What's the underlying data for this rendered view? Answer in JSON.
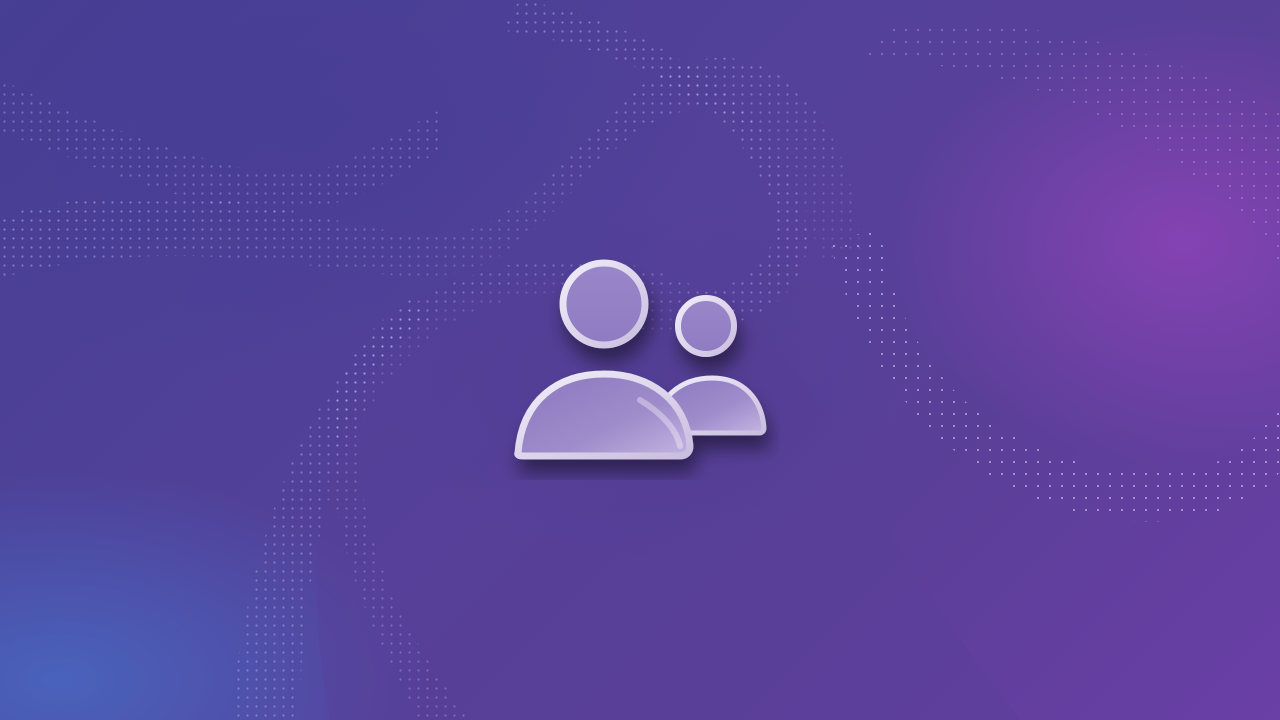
{
  "scene": {
    "icon": "users-icon",
    "colors": {
      "background_base": "#54419a",
      "background_magenta": "#a846c8",
      "background_blue": "#466ec8",
      "dot_pattern": "#b9a4f0",
      "icon_fill": "#9d8bc7",
      "icon_outline": "#e4def0"
    }
  }
}
